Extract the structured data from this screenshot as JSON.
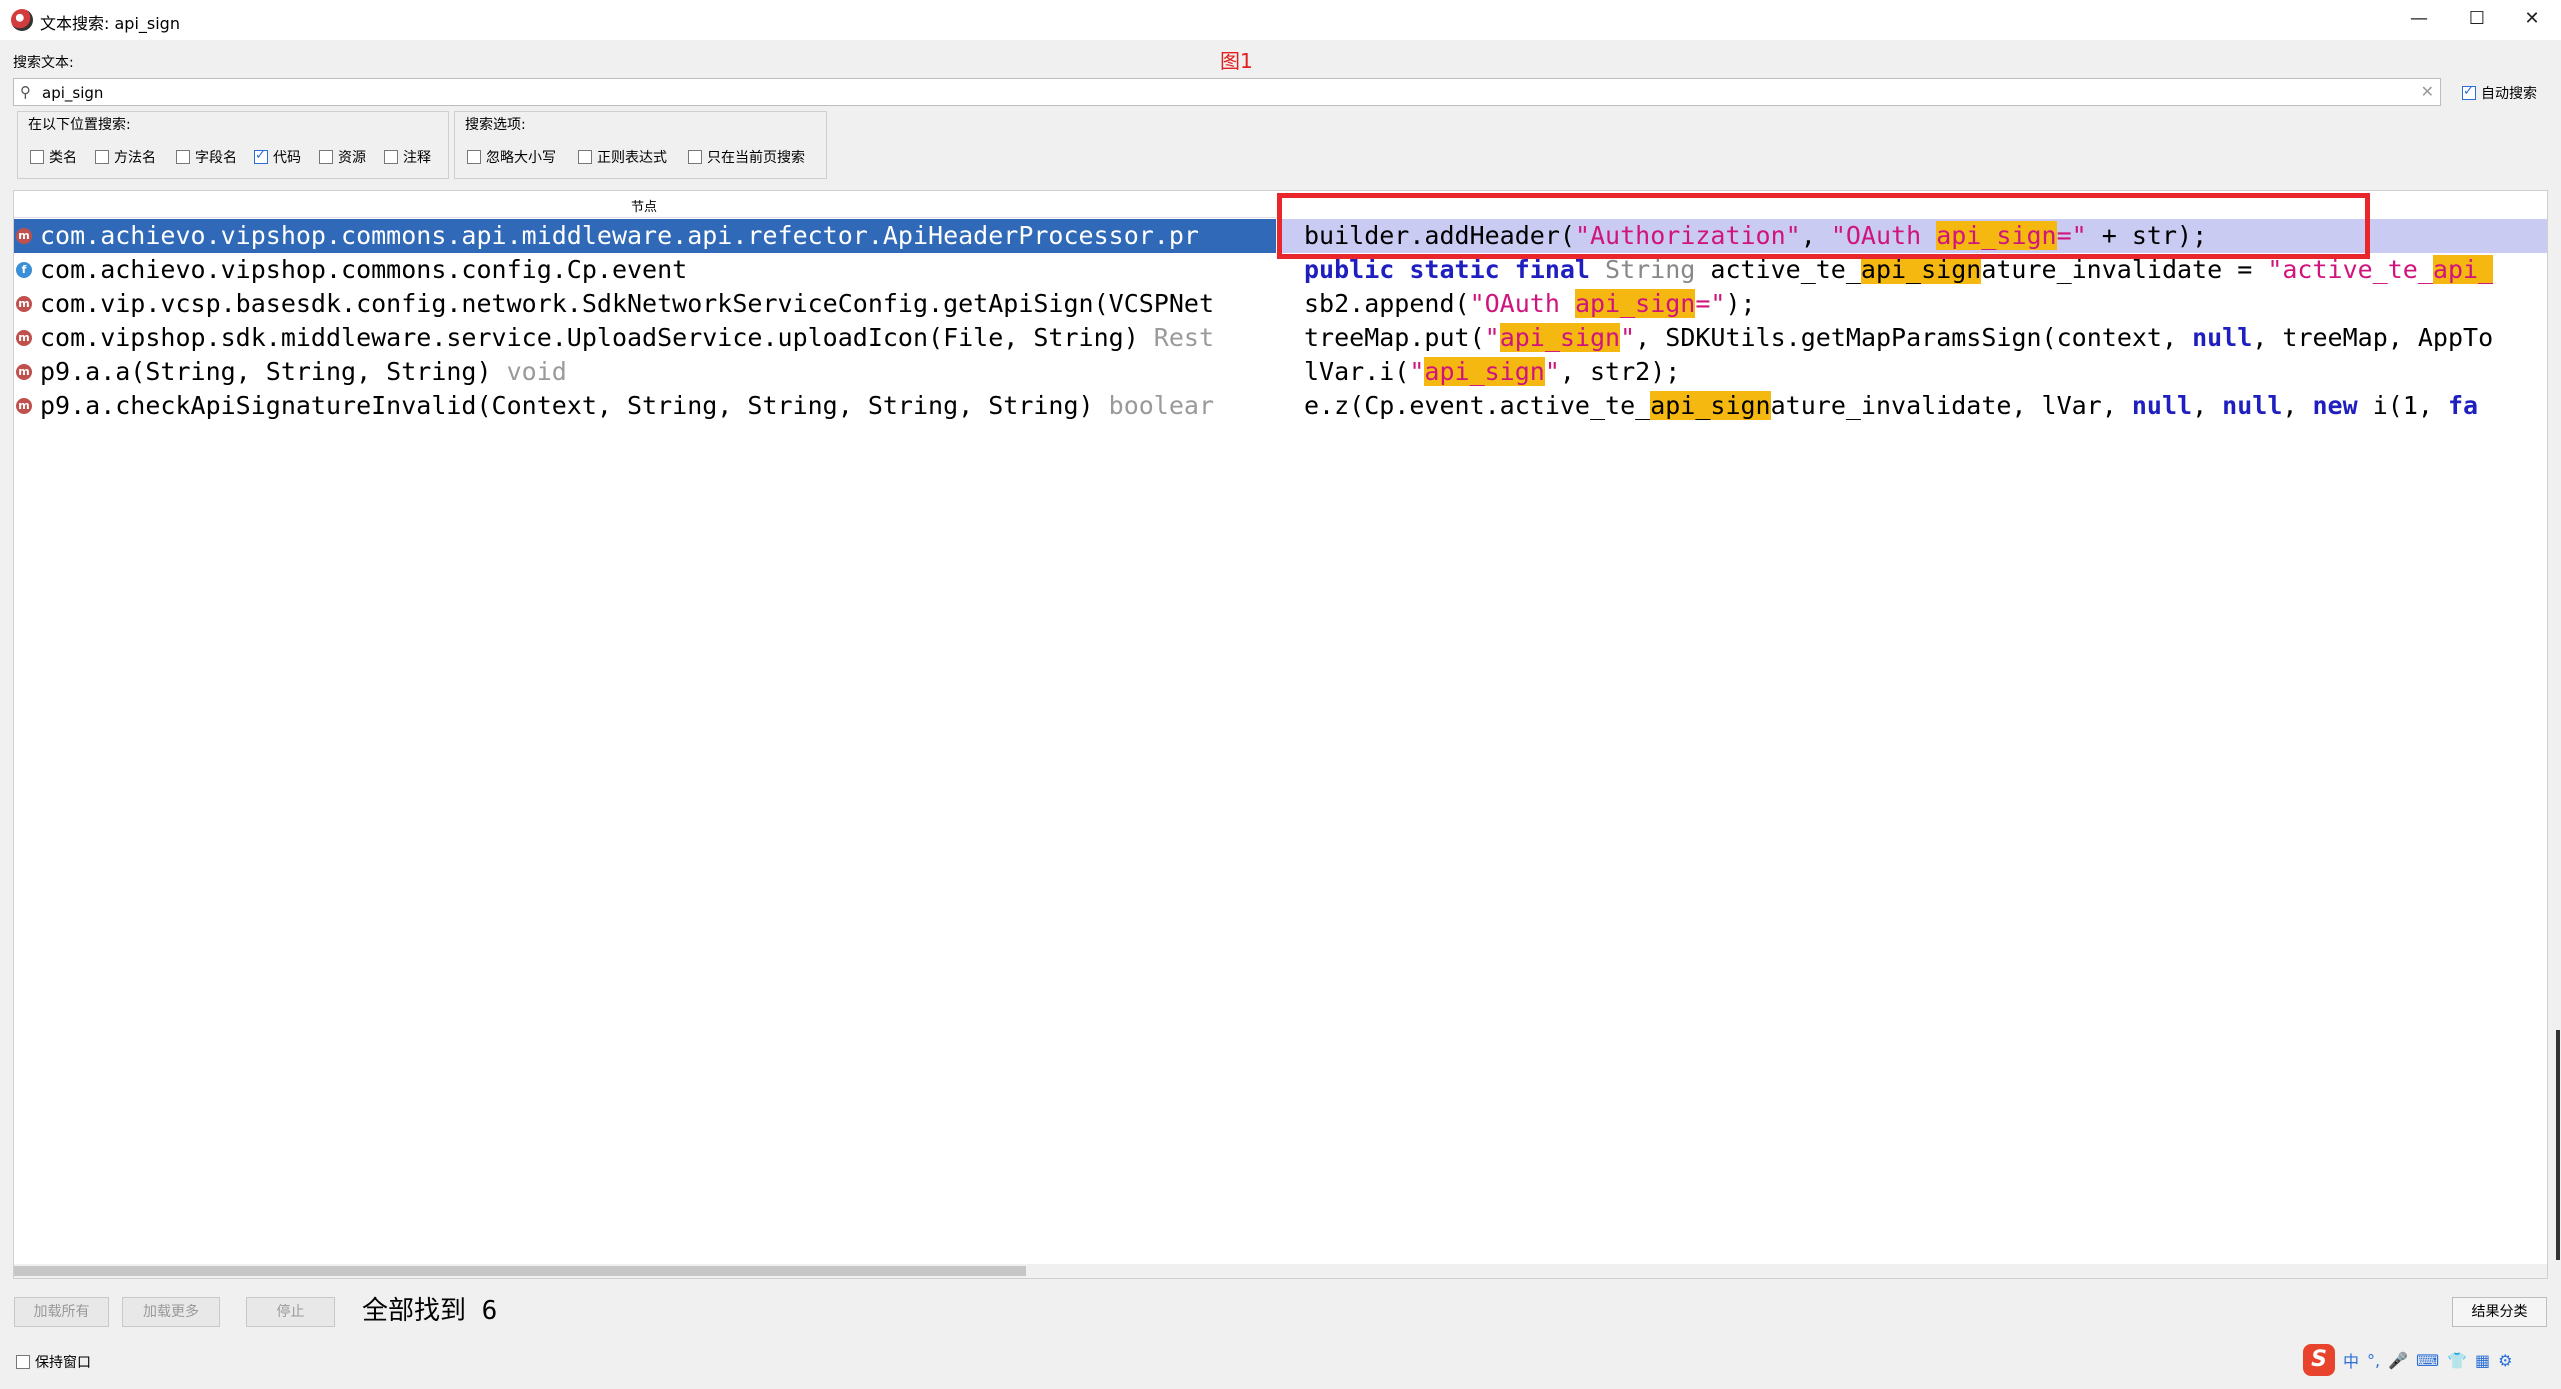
{
  "window": {
    "title": "文本搜索: api_sign",
    "minimize": "—",
    "maximize": "☐",
    "close": "✕"
  },
  "annotation": {
    "figure_label": "图1"
  },
  "search": {
    "label": "搜索文本:",
    "value": "api_sign",
    "auto_search_label": "自动搜索",
    "auto_search_checked": true
  },
  "search_in": {
    "title": "在以下位置搜索:",
    "options": [
      {
        "label": "类名",
        "checked": false
      },
      {
        "label": "方法名",
        "checked": false
      },
      {
        "label": "字段名",
        "checked": false
      },
      {
        "label": "代码",
        "checked": true
      },
      {
        "label": "资源",
        "checked": false
      },
      {
        "label": "注释",
        "checked": false
      }
    ]
  },
  "search_options": {
    "title": "搜索选项:",
    "options": [
      {
        "label": "忽略大小写",
        "checked": false
      },
      {
        "label": "正则表达式",
        "checked": false
      },
      {
        "label": "只在当前页搜索",
        "checked": false
      }
    ]
  },
  "results": {
    "column_header": "节点",
    "rows": [
      {
        "icon": "m",
        "text": "com.achievo.vipshop.commons.api.middleware.api.refector.ApiHeaderProcessor.pr",
        "type": ""
      },
      {
        "icon": "f",
        "text": "com.achievo.vipshop.commons.config.Cp.event",
        "type": ""
      },
      {
        "icon": "m",
        "text": "com.vip.vcsp.basesdk.config.network.SdkNetworkServiceConfig.getApiSign(VCSPNet",
        "type": ""
      },
      {
        "icon": "m",
        "text": "com.vipshop.sdk.middleware.service.UploadService.uploadIcon(File, String) ",
        "type": "Rest"
      },
      {
        "icon": "m",
        "text": "p9.a.a(String, String, String) ",
        "type": "void"
      },
      {
        "icon": "m",
        "text": "p9.a.checkApiSignatureInvalid(Context, String, String, String, String) ",
        "type": "boolear"
      }
    ],
    "code_lines": [
      [
        {
          "t": "builder.addHeader("
        },
        {
          "t": "\"Authorization\"",
          "c": "str"
        },
        {
          "t": ", "
        },
        {
          "t": "\"OAuth ",
          "c": "str"
        },
        {
          "t": "api_sign",
          "c": "str hl"
        },
        {
          "t": "=\"",
          "c": "str"
        },
        {
          "t": " + str);"
        }
      ],
      [
        {
          "t": "public static final ",
          "c": "kw"
        },
        {
          "t": "String ",
          "c": "typ"
        },
        {
          "t": "active_te_"
        },
        {
          "t": "api_sign",
          "c": "hl"
        },
        {
          "t": "ature_invalidate = "
        },
        {
          "t": "\"active_te_",
          "c": "str"
        },
        {
          "t": "api_",
          "c": "str hl"
        }
      ],
      [
        {
          "t": "sb2.append("
        },
        {
          "t": "\"OAuth ",
          "c": "str"
        },
        {
          "t": "api_sign",
          "c": "str hl"
        },
        {
          "t": "=\"",
          "c": "str"
        },
        {
          "t": ");"
        }
      ],
      [
        {
          "t": "treeMap.put("
        },
        {
          "t": "\"",
          "c": "str"
        },
        {
          "t": "api_sign",
          "c": "str hl"
        },
        {
          "t": "\"",
          "c": "str"
        },
        {
          "t": ", SDKUtils.getMapParamsSign(context, "
        },
        {
          "t": "null",
          "c": "kw"
        },
        {
          "t": ", treeMap, AppTo"
        }
      ],
      [
        {
          "t": "lVar.i("
        },
        {
          "t": "\"",
          "c": "str"
        },
        {
          "t": "api_sign",
          "c": "str hl"
        },
        {
          "t": "\"",
          "c": "str"
        },
        {
          "t": ", str2);"
        }
      ],
      [
        {
          "t": "e.z(Cp.event.active_te_"
        },
        {
          "t": "api_sign",
          "c": "hl"
        },
        {
          "t": "ature_invalidate, lVar, "
        },
        {
          "t": "null",
          "c": "kw"
        },
        {
          "t": ", "
        },
        {
          "t": "null",
          "c": "kw"
        },
        {
          "t": ", "
        },
        {
          "t": "new ",
          "c": "kw"
        },
        {
          "t": "i(1, "
        },
        {
          "t": "fa",
          "c": "kw"
        }
      ]
    ]
  },
  "footer": {
    "load_all": "加载所有",
    "load_more": "加载更多",
    "stop": "停止",
    "found_text": "全部找到 6",
    "sort_results": "结果分类",
    "keep_window": "保持窗口",
    "keep_window_checked": false
  },
  "ime": {
    "logo": "S",
    "lang": "中",
    "punct": "°,"
  }
}
